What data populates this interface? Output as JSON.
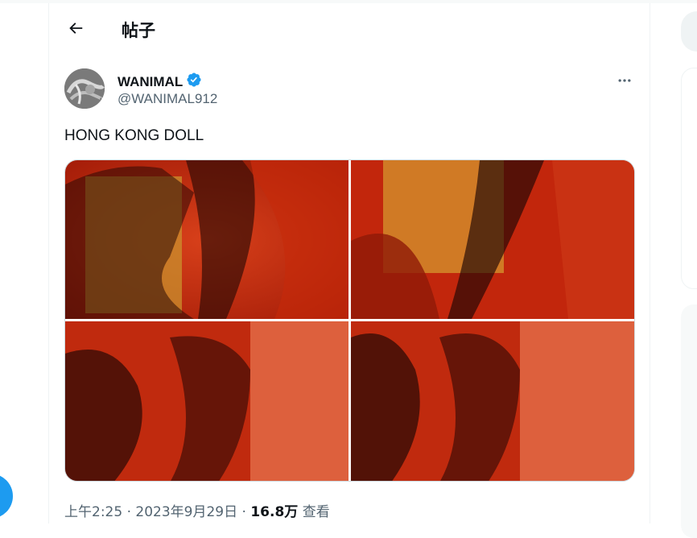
{
  "header": {
    "title": "帖子",
    "back_icon": "arrow-left-icon"
  },
  "author": {
    "display_name": "WANIMAL",
    "handle": "@WANIMAL912",
    "verified_icon": "verified-badge-icon",
    "verified_color": "#1d9bf0"
  },
  "tweet": {
    "text": "HONG KONG DOLL",
    "media_count": 4,
    "time": "上午2:25",
    "separator": "·",
    "date": "2023年9月29日",
    "views_count": "16.8万",
    "views_label": "查看"
  },
  "colors": {
    "accent": "#1d9bf0",
    "text": "#0f1419",
    "secondary": "#536471",
    "border": "#cfd9de"
  }
}
